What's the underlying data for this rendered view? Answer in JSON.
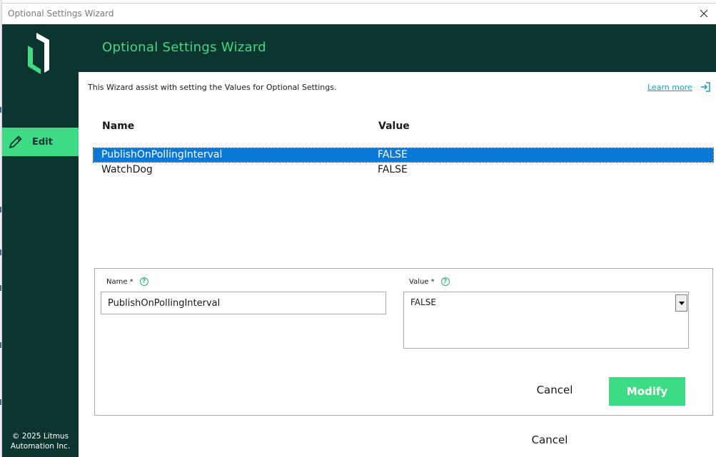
{
  "window": {
    "title": "Optional Settings Wizard"
  },
  "sidebar": {
    "nav": [
      {
        "label": "Edit",
        "icon": "pencil-icon",
        "active": true
      }
    ],
    "copyright_line1": "© 2025 Litmus",
    "copyright_line2": "Automation Inc."
  },
  "header": {
    "title": "Optional Settings Wizard"
  },
  "intro": "This Wizard assist with setting the Values for Optional Settings.",
  "learn_more": "Learn more",
  "table": {
    "columns": [
      "Name",
      "Value"
    ],
    "rows": [
      {
        "name": "PublishOnPollingInterval",
        "value": "FALSE",
        "selected": true
      },
      {
        "name": "WatchDog",
        "value": "FALSE",
        "selected": false
      }
    ]
  },
  "form": {
    "name_label": "Name *",
    "name_value": "PublishOnPollingInterval",
    "value_label": "Value *",
    "value_selected": "FALSE",
    "help_glyph": "?",
    "cancel_label": "Cancel",
    "modify_label": "Modify"
  },
  "footer": {
    "cancel_label": "Cancel"
  },
  "colors": {
    "brand_dark": "#0c3530",
    "brand_green": "#3ddc84",
    "selection": "#0a78d7",
    "link": "#1e9bb8"
  }
}
